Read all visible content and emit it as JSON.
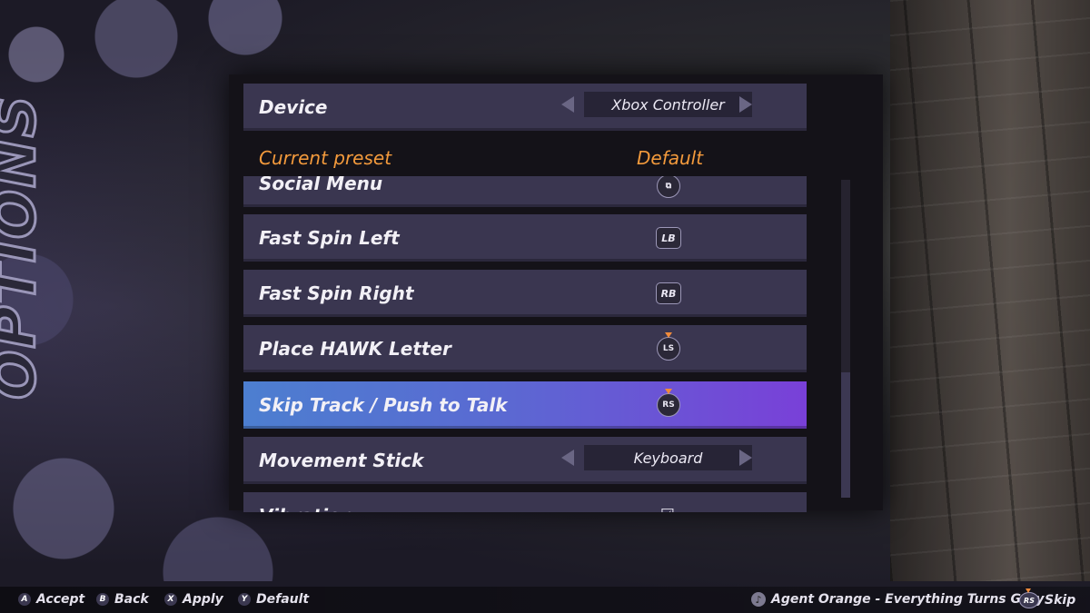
{
  "sidebar": {
    "title": "OPTIONS"
  },
  "device": {
    "label": "Device",
    "value": "Xbox Controller"
  },
  "preset": {
    "label": "Current preset",
    "value": "Default"
  },
  "bindings": [
    {
      "label": "Social Menu",
      "glyph": "⧉",
      "glyph_type": "view-button"
    },
    {
      "label": "Fast Spin Left",
      "glyph": "LB",
      "glyph_type": "bumper"
    },
    {
      "label": "Fast Spin Right",
      "glyph": "RB",
      "glyph_type": "bumper"
    },
    {
      "label": "Place HAWK Letter",
      "glyph": "LS",
      "glyph_type": "stick"
    },
    {
      "label": "Skip Track / Push to Talk",
      "glyph": "RS",
      "glyph_type": "stick",
      "selected": true
    },
    {
      "label": "Movement Stick",
      "value": "Keyboard",
      "glyph_type": "selector"
    },
    {
      "label": "Vibration",
      "glyph": "☑",
      "glyph_type": "checkbox"
    }
  ],
  "footer": {
    "hints": [
      {
        "button": "A",
        "label": "Accept"
      },
      {
        "button": "B",
        "label": "Back"
      },
      {
        "button": "X",
        "label": "Apply"
      },
      {
        "button": "Y",
        "label": "Default"
      }
    ],
    "now_playing": "Agent Orange - Everything Turns Grey",
    "skip": {
      "button": "RS",
      "label": "Skip"
    }
  },
  "colors": {
    "accent": "#f39a3c",
    "row": "#3a3650",
    "selected_from": "#4c7fd0",
    "selected_to": "#7a3fd8"
  }
}
